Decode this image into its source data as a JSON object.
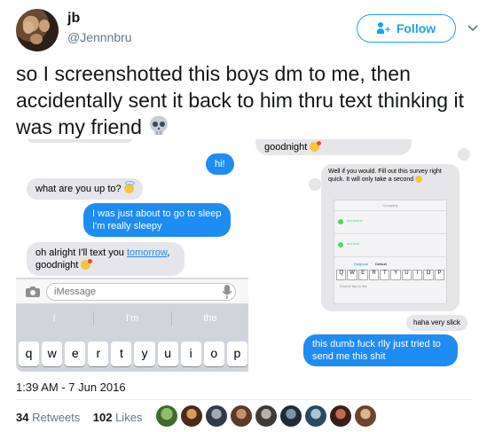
{
  "user": {
    "name": "jb",
    "handle": "@Jennnbru"
  },
  "follow_label": "Follow",
  "tweet": {
    "text": "so I screenshotted this boys dm to me, then accidentally sent it back to him thru text thinking it was my friend"
  },
  "left_screenshot": {
    "messages": [
      {
        "side": "right",
        "text": "hi!"
      },
      {
        "side": "left",
        "text": "what are you up to?"
      },
      {
        "side": "right",
        "text": "I was just about to go to sleep I'm really sleepy"
      },
      {
        "side": "left",
        "text_before": "oh alright I'll text you ",
        "link": "tomorrow",
        "text_after": ", goodnight"
      }
    ],
    "input_placeholder": "iMessage",
    "suggestions": [
      "I",
      "I'm",
      "the"
    ],
    "keys": [
      "q",
      "w",
      "e",
      "r",
      "t",
      "y",
      "u",
      "i",
      "o",
      "p"
    ]
  },
  "right_screenshot": {
    "top_bubble": "goodnight",
    "survey_bubble": "Well if you would. Fill out this survey right quick. It will only take a second",
    "tiny_rows": [
      "Company",
      "ant phone",
      "ant wall"
    ],
    "tiny_settings": {
      "left": "Ringtone",
      "right": "Default"
    },
    "tiny_keys": [
      "Q",
      "W",
      "E",
      "R",
      "T",
      "Y",
      "U",
      "I",
      "O",
      "P"
    ],
    "tiny_footer": "Double tap to like",
    "gray_bubble": "haha very slick",
    "blue_bubble": "this dumb fuck rlly just tried to send me this shit"
  },
  "timestamp": "1:39 AM - 7 Jun 2016",
  "stats": {
    "retweets_count": "34",
    "retweets_label": "Retweets",
    "likes_count": "102",
    "likes_label": "Likes"
  },
  "colors": {
    "twitter_blue": "#1da1f2",
    "imessage_blue": "#1e8cf3",
    "imessage_gray": "#e5e5ea"
  }
}
